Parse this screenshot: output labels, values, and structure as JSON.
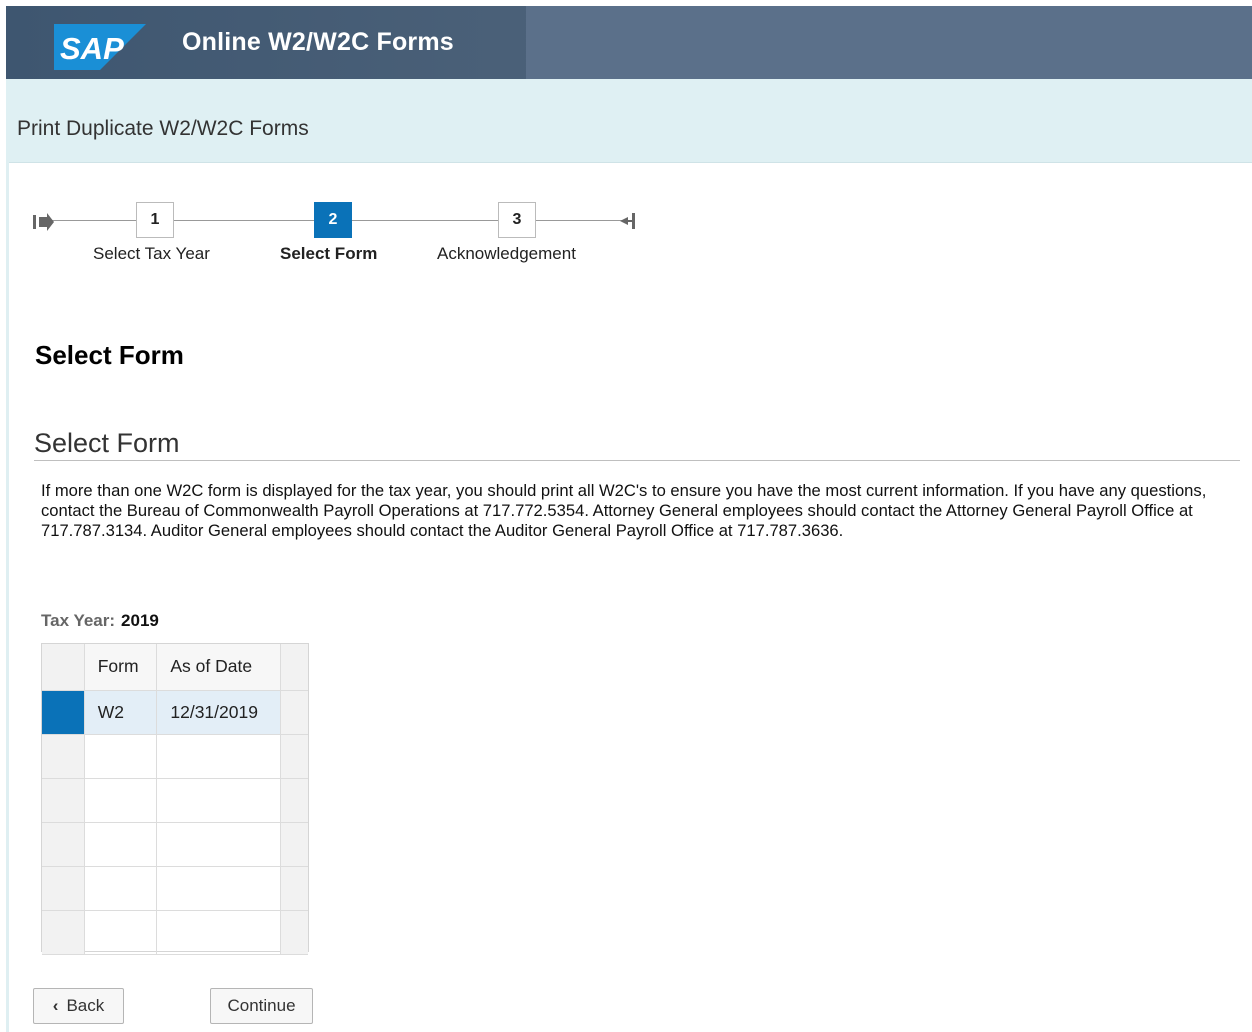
{
  "shell": {
    "logo_text": "SAP",
    "title": "Online W2/W2C Forms",
    "colors": {
      "header_bg": "#3e5670",
      "accent": "#0a72b8",
      "subheader_bg": "#dff0f3"
    }
  },
  "subheader": {
    "title": "Print Duplicate W2/W2C Forms"
  },
  "roadmap": {
    "steps": [
      {
        "number": "1",
        "label": "Select Tax Year",
        "active": false
      },
      {
        "number": "2",
        "label": "Select Form",
        "active": true
      },
      {
        "number": "3",
        "label": "Acknowledgement",
        "active": false
      }
    ]
  },
  "page": {
    "heading": "Select Form",
    "section_title": "Select Form",
    "info_text": "If more than one W2C form is displayed for the tax year, you should print all W2C's to ensure you have the most current information. If you have any questions, contact the Bureau of Commonwealth Payroll Operations at 717.772.5354. Attorney General employees should contact the Attorney General Payroll Office at 717.787.3134. Auditor General employees should contact the Auditor General Payroll Office at 717.787.3636."
  },
  "tax_year": {
    "label": "Tax Year:",
    "value": "2019"
  },
  "table": {
    "columns": [
      "Form",
      "As of Date"
    ],
    "rows": [
      {
        "form": "W2",
        "as_of_date": "12/31/2019",
        "selected": true
      }
    ],
    "empty_rows": 5
  },
  "buttons": {
    "back": "Back",
    "continue": "Continue"
  }
}
